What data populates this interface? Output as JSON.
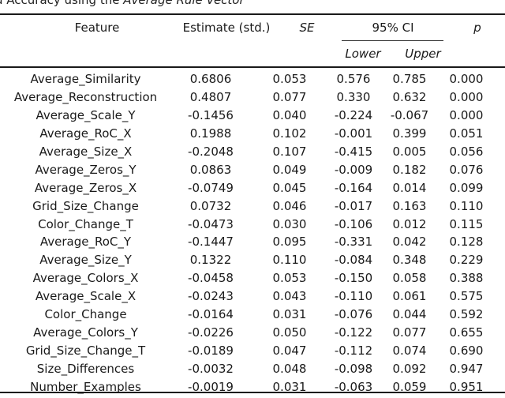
{
  "caption": {
    "prefix": "d Accuracy using the ",
    "emphasis": "Average Rule Vector"
  },
  "table": {
    "headers": {
      "feature": "Feature",
      "estimate": "Estimate (std.)",
      "se": "SE",
      "ci": "95% CI",
      "lower": "Lower",
      "upper": "Upper",
      "p": "p"
    },
    "rows": [
      [
        "Average_Similarity",
        "0.6806",
        "0.053",
        "0.576",
        "0.785",
        "0.000"
      ],
      [
        "Average_Reconstruction",
        "0.4807",
        "0.077",
        "0.330",
        "0.632",
        "0.000"
      ],
      [
        "Average_Scale_Y",
        "-0.1456",
        "0.040",
        "-0.224",
        "-0.067",
        "0.000"
      ],
      [
        "Average_RoC_X",
        "0.1988",
        "0.102",
        "-0.001",
        "0.399",
        "0.051"
      ],
      [
        "Average_Size_X",
        "-0.2048",
        "0.107",
        "-0.415",
        "0.005",
        "0.056"
      ],
      [
        "Average_Zeros_Y",
        "0.0863",
        "0.049",
        "-0.009",
        "0.182",
        "0.076"
      ],
      [
        "Average_Zeros_X",
        "-0.0749",
        "0.045",
        "-0.164",
        "0.014",
        "0.099"
      ],
      [
        "Grid_Size_Change",
        "0.0732",
        "0.046",
        "-0.017",
        "0.163",
        "0.110"
      ],
      [
        "Color_Change_T",
        "-0.0473",
        "0.030",
        "-0.106",
        "0.012",
        "0.115"
      ],
      [
        "Average_RoC_Y",
        "-0.1447",
        "0.095",
        "-0.331",
        "0.042",
        "0.128"
      ],
      [
        "Average_Size_Y",
        "0.1322",
        "0.110",
        "-0.084",
        "0.348",
        "0.229"
      ],
      [
        "Average_Colors_X",
        "-0.0458",
        "0.053",
        "-0.150",
        "0.058",
        "0.388"
      ],
      [
        "Average_Scale_X",
        "-0.0243",
        "0.043",
        "-0.110",
        "0.061",
        "0.575"
      ],
      [
        "Color_Change",
        "-0.0164",
        "0.031",
        "-0.076",
        "0.044",
        "0.592"
      ],
      [
        "Average_Colors_Y",
        "-0.0226",
        "0.050",
        "-0.122",
        "0.077",
        "0.655"
      ],
      [
        "Grid_Size_Change_T",
        "-0.0189",
        "0.047",
        "-0.112",
        "0.074",
        "0.690"
      ],
      [
        "Size_Differences",
        "-0.0032",
        "0.048",
        "-0.098",
        "0.092",
        "0.947"
      ],
      [
        "Number_Examples",
        "-0.0019",
        "0.031",
        "-0.063",
        "0.059",
        "0.951"
      ]
    ]
  }
}
